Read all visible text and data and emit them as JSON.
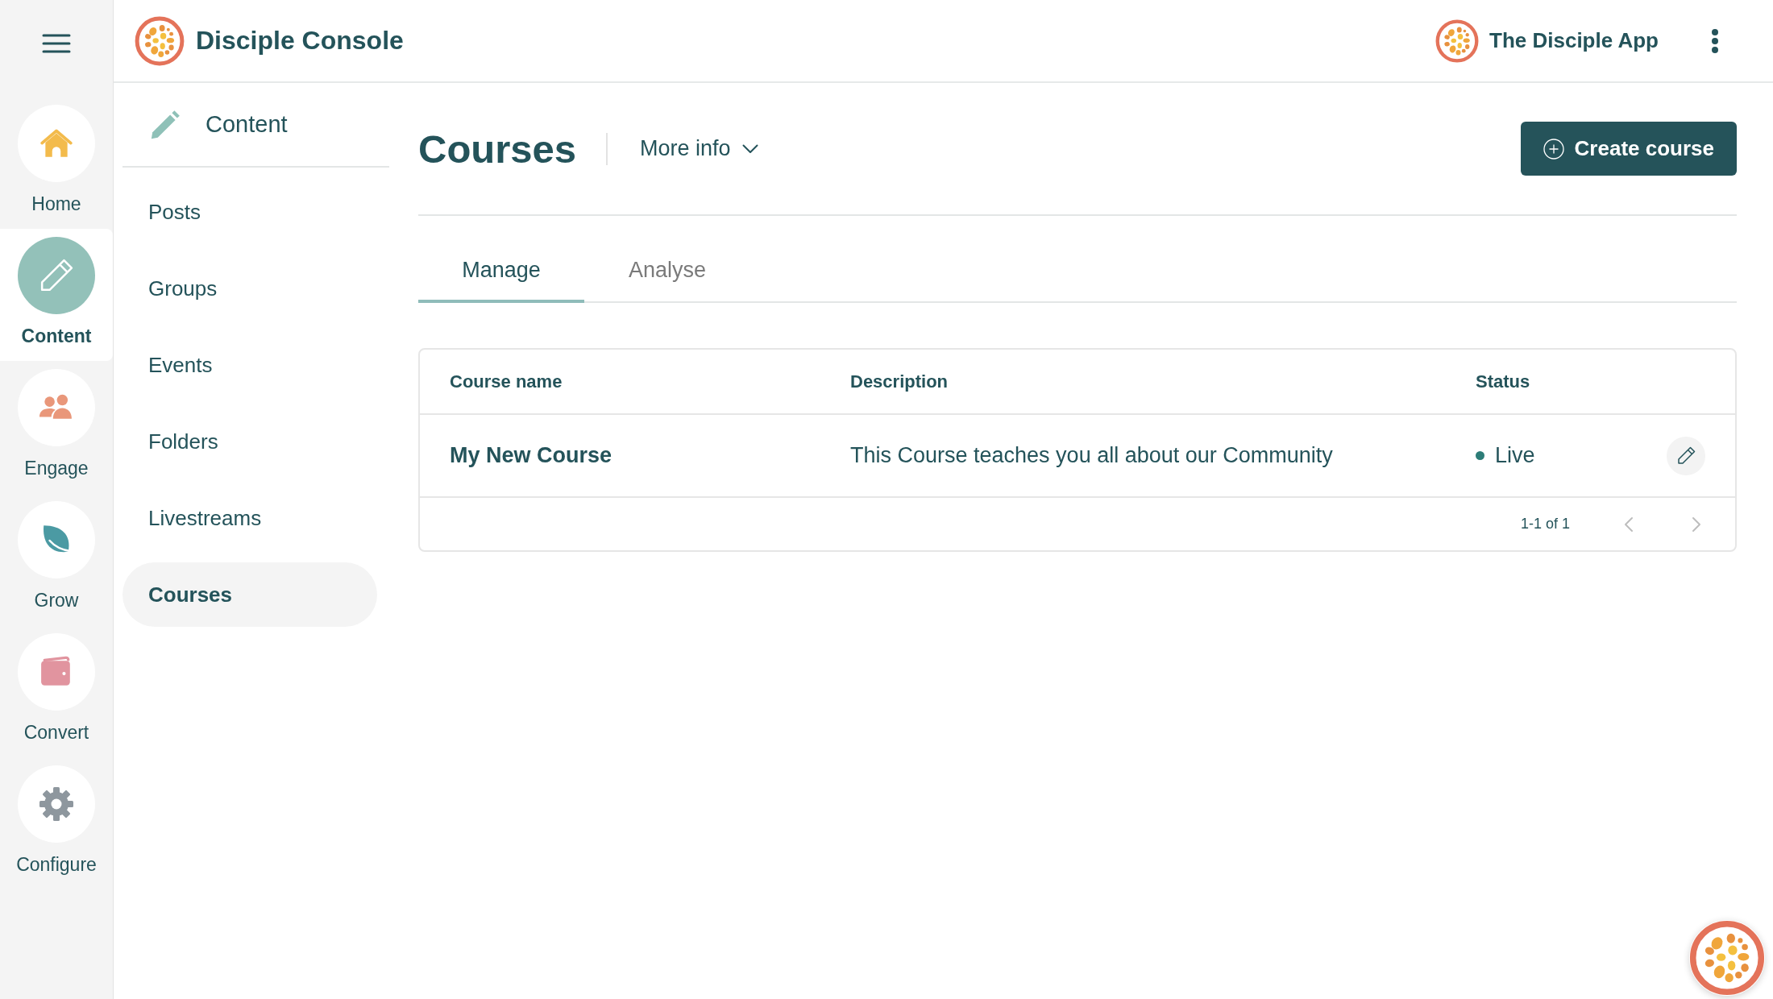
{
  "rail": {
    "items": [
      {
        "label": "Home",
        "selected": false
      },
      {
        "label": "Content",
        "selected": true
      },
      {
        "label": "Engage",
        "selected": false
      },
      {
        "label": "Grow",
        "selected": false
      },
      {
        "label": "Convert",
        "selected": false
      },
      {
        "label": "Configure",
        "selected": false
      }
    ]
  },
  "header": {
    "title": "Disciple Console",
    "app_name": "The Disciple App"
  },
  "sidebar": {
    "title": "Content",
    "items": [
      {
        "label": "Posts",
        "selected": false
      },
      {
        "label": "Groups",
        "selected": false
      },
      {
        "label": "Events",
        "selected": false
      },
      {
        "label": "Folders",
        "selected": false
      },
      {
        "label": "Livestreams",
        "selected": false
      },
      {
        "label": "Courses",
        "selected": true
      }
    ]
  },
  "page": {
    "title": "Courses",
    "more_info": "More info",
    "create_button": "Create course"
  },
  "tabs": [
    {
      "label": "Manage",
      "selected": true
    },
    {
      "label": "Analyse",
      "selected": false
    }
  ],
  "table": {
    "columns": [
      "Course name",
      "Description",
      "Status"
    ],
    "rows": [
      {
        "name": "My New Course",
        "description": "This Course teaches you all about our Community",
        "status": "Live",
        "color": "#2d7d78"
      }
    ],
    "pagination": {
      "range": "1-1 of 1",
      "previous": {
        "disabled": true
      },
      "next": {
        "disabled": true
      }
    }
  }
}
